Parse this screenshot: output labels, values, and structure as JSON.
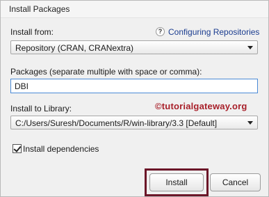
{
  "window": {
    "title": "Install Packages"
  },
  "install_from": {
    "label": "Install from:",
    "help_icon": "question-icon",
    "help_glyph": "?",
    "help_link": "Configuring Repositories",
    "selected": "Repository (CRAN, CRANextra)"
  },
  "packages": {
    "label": "Packages (separate multiple with space or comma):",
    "value": "DBI"
  },
  "library": {
    "label": "Install to Library:",
    "selected": "C:/Users/Suresh/Documents/R/win-library/3.3 [Default]"
  },
  "watermark": "©tutorialgateway.org",
  "dependencies": {
    "label": "Install dependencies",
    "checked": true
  },
  "buttons": {
    "install": "Install",
    "cancel": "Cancel"
  },
  "colors": {
    "highlight": "#6b1628",
    "watermark": "#a8202a",
    "link": "#1a3c8f"
  }
}
